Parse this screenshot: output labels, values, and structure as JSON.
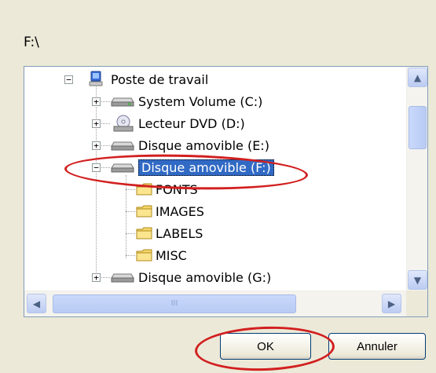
{
  "path": "F:\\",
  "tree": {
    "root": {
      "label": "Poste de travail",
      "expander": "−"
    },
    "drives": [
      {
        "label": "System Volume (C:)",
        "expander": "+",
        "icon": "hard-drive-icon"
      },
      {
        "label": "Lecteur DVD (D:)",
        "expander": "+",
        "icon": "dvd-drive-icon"
      },
      {
        "label": "Disque amovible (E:)",
        "expander": "+",
        "icon": "removable-drive-icon"
      },
      {
        "label": "Disque amovible (F:)",
        "expander": "−",
        "icon": "removable-drive-icon",
        "selected": true
      },
      {
        "label": "Disque amovible (G:)",
        "expander": "+",
        "icon": "removable-drive-icon"
      }
    ],
    "folders": [
      {
        "label": "FONTS"
      },
      {
        "label": "IMAGES"
      },
      {
        "label": "LABELS"
      },
      {
        "label": "MISC"
      }
    ]
  },
  "scroll": {
    "up": "▲",
    "down": "▼",
    "left": "◀",
    "right": "▶",
    "grip": "III"
  },
  "buttons": {
    "ok": "OK",
    "cancel": "Annuler"
  },
  "colors": {
    "selection": "#316ac5",
    "annotation": "#d21f1f",
    "dialog_bg": "#ece9d8"
  }
}
